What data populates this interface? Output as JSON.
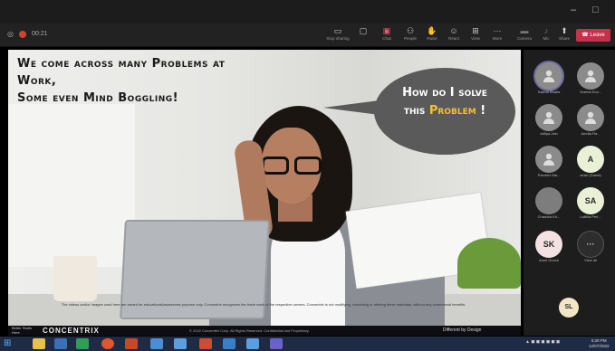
{
  "window": {
    "minimize": "–",
    "maximize": "□"
  },
  "toolbar": {
    "timer": "00:21",
    "buttons": [
      {
        "label": "Stop sharing",
        "icon": "screen-share-icon"
      },
      {
        "label": "",
        "icon": "share-tray-icon"
      },
      {
        "label": "Chat",
        "icon": "chat-icon"
      },
      {
        "label": "People",
        "icon": "people-icon"
      },
      {
        "label": "Raise",
        "icon": "hand-icon"
      },
      {
        "label": "React",
        "icon": "smile-icon"
      },
      {
        "label": "View",
        "icon": "grid-icon"
      },
      {
        "label": "More",
        "icon": "more-icon"
      },
      {
        "label": "Camera",
        "icon": "camera-icon"
      },
      {
        "label": "Mic",
        "icon": "mic-icon"
      },
      {
        "label": "Share",
        "icon": "share-icon"
      }
    ],
    "leave_label": "Leave",
    "colors": {
      "leave": "#c4314b",
      "toolbar_bg": "#222222"
    }
  },
  "slide": {
    "title_line1": "We come across many Problems at Work,",
    "title_line2": "Some even Mind Boggling!",
    "bubble_line1": "How do I solve",
    "bubble_line2_pre": "this ",
    "bubble_line2_highlight": "Problem",
    "bubble_line2_post": " !",
    "disclaimer": "The videos and/or images used here are meant for educational/awareness purpose only. Concentrix recognizes the trade mark of the respective owners. Concentrix is not modifying, circulating or altering these materials, without any commercial benefits.",
    "brand": "CONCENTRIX",
    "logo_mark": "Better Starts Here",
    "copyright": "© 2022 Concentrix Corp. All Rights Reserved. Confidential and Proprietary.",
    "tagline": "Different by Design",
    "colors": {
      "highlight": "#f2c12e",
      "bubble": "#5a5a5a"
    }
  },
  "participants": [
    {
      "name": "Sakina Bhatia",
      "type": "photo"
    },
    {
      "name": "Snehal Kha...",
      "type": "photo"
    },
    {
      "name": "Aditya Jain",
      "type": "photo"
    },
    {
      "name": "Amrita Ra...",
      "type": "photo"
    },
    {
      "name": "Parveez Ma...",
      "type": "photo"
    },
    {
      "name": "anan (Guest)",
      "type": "initials",
      "initials": "A",
      "color": "#e9f0d6"
    },
    {
      "name": "Chandra Kh...",
      "type": "blank"
    },
    {
      "name": "Lalitha Peri...",
      "type": "initials",
      "initials": "SA",
      "color": "#e9f0d6"
    },
    {
      "name": "Amol Ghosh",
      "type": "initials",
      "initials": "SK",
      "color": "#f5e1e1"
    },
    {
      "name": "View all",
      "type": "more",
      "initials": "···"
    }
  ],
  "self_view": {
    "initials": "SL"
  },
  "taskbar": {
    "start": "⊞",
    "clock_time": "5:28 PM",
    "clock_date": "12/07/2022"
  }
}
